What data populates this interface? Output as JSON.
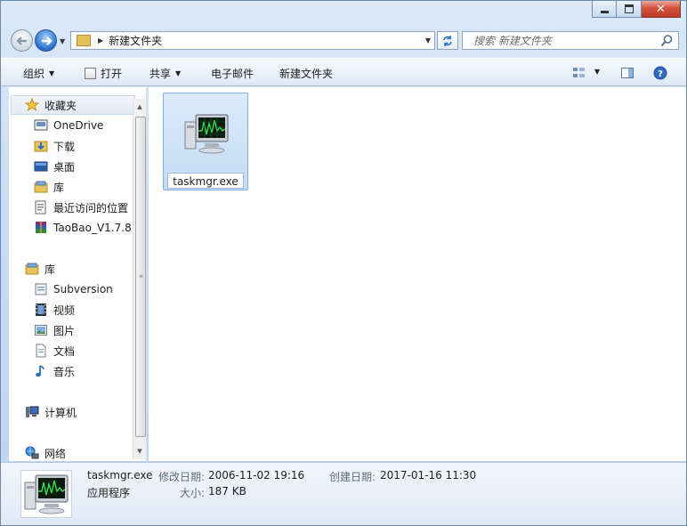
{
  "window": {
    "caption_buttons": [
      "minimize",
      "maximize",
      "close"
    ]
  },
  "address_bar": {
    "path": "新建文件夹"
  },
  "search": {
    "placeholder": "搜索 新建文件夹"
  },
  "toolbar": {
    "organize": "组织",
    "open": "打开",
    "share": "共享",
    "email": "电子邮件",
    "new_folder": "新建文件夹"
  },
  "nav_pane": {
    "favorites": {
      "label": "收藏夹",
      "items": [
        {
          "label": "OneDrive",
          "icon": "onedrive-icon"
        },
        {
          "label": "下载",
          "icon": "downloads-folder-icon"
        },
        {
          "label": "桌面",
          "icon": "desktop-icon"
        },
        {
          "label": "库",
          "icon": "library-icon"
        },
        {
          "label": "最近访问的位置",
          "icon": "recent-places-icon"
        },
        {
          "label": "TaoBao_V1.7.8.",
          "icon": "winrar-archive-icon"
        }
      ]
    },
    "libraries": {
      "label": "库",
      "items": [
        {
          "label": "Subversion",
          "icon": "document-library-icon"
        },
        {
          "label": "视频",
          "icon": "video-library-icon"
        },
        {
          "label": "图片",
          "icon": "picture-library-icon"
        },
        {
          "label": "文档",
          "icon": "document-library-icon"
        },
        {
          "label": "音乐",
          "icon": "music-library-icon"
        }
      ]
    },
    "computer": {
      "label": "计算机"
    },
    "network": {
      "label": "网络"
    }
  },
  "files": [
    {
      "name": "taskmgr.exe",
      "icon": "task-manager-icon",
      "selected": true
    }
  ],
  "details": {
    "name": "taskmgr.exe",
    "type": "应用程序",
    "modified_label": "修改日期:",
    "modified_value": "2006-11-02 19:16",
    "size_label": "大小:",
    "size_value": "187 KB",
    "created_label": "创建日期:",
    "created_value": "2017-01-16 11:30"
  },
  "colors": {
    "window_frame": "#c9dcf2",
    "selection": "#cfe3f8",
    "close_button": "#c9432f"
  }
}
